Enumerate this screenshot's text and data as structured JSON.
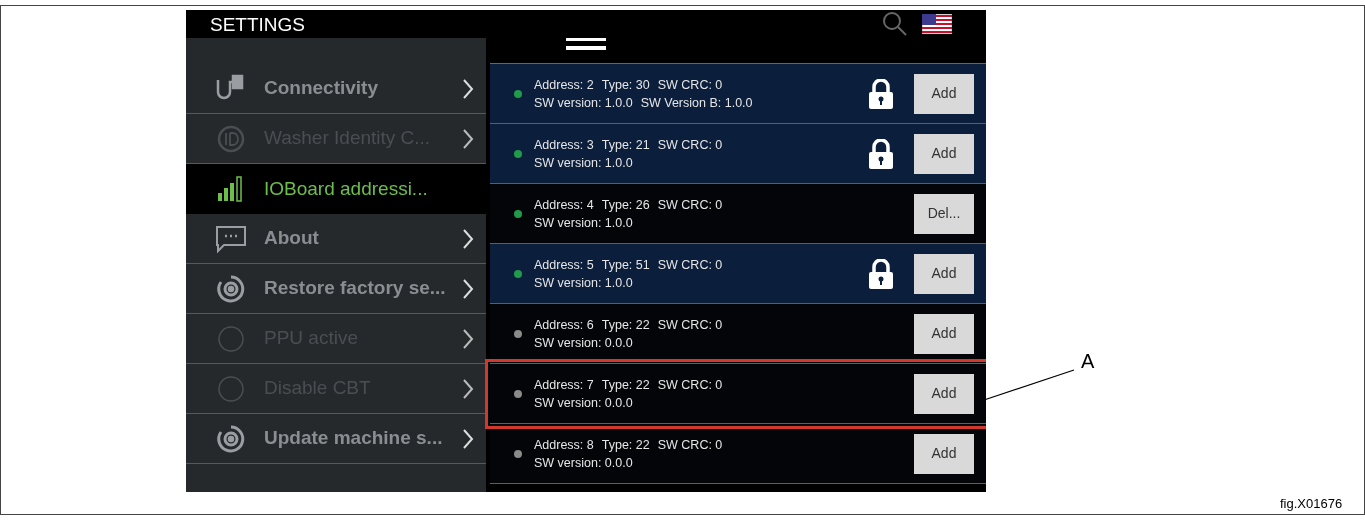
{
  "header": {
    "title": "SETTINGS"
  },
  "sidebar": {
    "items": [
      {
        "kind": "plug",
        "label": "Connectivity",
        "selected": false,
        "disabled": false
      },
      {
        "kind": "id",
        "label": "Washer Identity C...",
        "selected": false,
        "disabled": true
      },
      {
        "kind": "bars",
        "label": "IOBoard addressi...",
        "selected": true,
        "disabled": false
      },
      {
        "kind": "chat",
        "label": "About",
        "selected": false,
        "disabled": false
      },
      {
        "kind": "gear",
        "label": "Restore factory se...",
        "selected": false,
        "disabled": false
      },
      {
        "kind": "circle",
        "label": "PPU active",
        "selected": false,
        "disabled": true
      },
      {
        "kind": "circle",
        "label": "Disable CBT",
        "selected": false,
        "disabled": true
      },
      {
        "kind": "gear",
        "label": "Update machine s...",
        "selected": false,
        "disabled": false
      }
    ]
  },
  "devices": [
    {
      "address": "Address: 2",
      "type": "Type: 30",
      "crc": "SW CRC: 0",
      "version": "SW version: 1.0.0",
      "version_b": "SW Version B: 1.0.0",
      "online": true,
      "locked": true,
      "highlighted": true,
      "annotated": false,
      "action": "Add"
    },
    {
      "address": "Address: 3",
      "type": "Type: 21",
      "crc": "SW CRC: 0",
      "version": "SW version: 1.0.0",
      "online": true,
      "locked": true,
      "highlighted": true,
      "annotated": false,
      "action": "Add"
    },
    {
      "address": "Address: 4",
      "type": "Type: 26",
      "crc": "SW CRC: 0",
      "version": "SW version: 1.0.0",
      "online": true,
      "locked": false,
      "highlighted": false,
      "annotated": false,
      "action": "Del..."
    },
    {
      "address": "Address: 5",
      "type": "Type: 51",
      "crc": "SW CRC: 0",
      "version": "SW version: 1.0.0",
      "online": true,
      "locked": true,
      "highlighted": true,
      "annotated": false,
      "action": "Add"
    },
    {
      "address": "Address: 6",
      "type": "Type: 22",
      "crc": "SW CRC: 0",
      "version": "SW version: 0.0.0",
      "online": false,
      "locked": false,
      "highlighted": false,
      "annotated": false,
      "action": "Add"
    },
    {
      "address": "Address: 7",
      "type": "Type: 22",
      "crc": "SW CRC: 0",
      "version": "SW version: 0.0.0",
      "online": false,
      "locked": false,
      "highlighted": false,
      "annotated": true,
      "action": "Add"
    },
    {
      "address": "Address: 8",
      "type": "Type: 22",
      "crc": "SW CRC: 0",
      "version": "SW version: 0.0.0",
      "online": false,
      "locked": false,
      "highlighted": false,
      "annotated": false,
      "action": "Add"
    }
  ],
  "annotation": {
    "label": "A"
  },
  "caption": "fig.X01676"
}
